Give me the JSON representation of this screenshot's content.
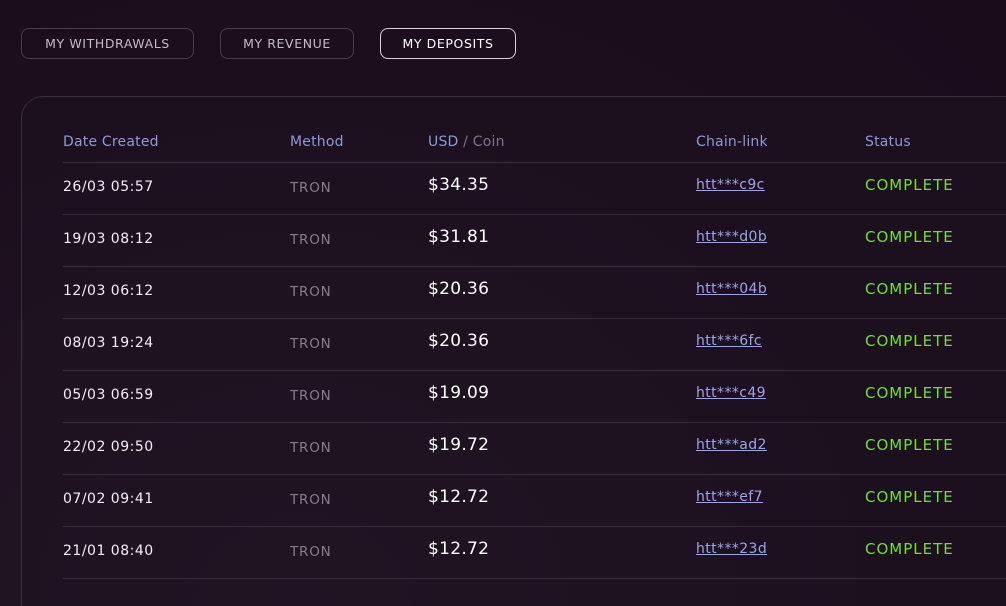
{
  "tabs": [
    {
      "label": "MY WITHDRAWALS",
      "active": false
    },
    {
      "label": "MY REVENUE",
      "active": false
    },
    {
      "label": "MY DEPOSITS",
      "active": true
    }
  ],
  "table": {
    "headers": {
      "date": "Date Created",
      "method": "Method",
      "usd": "USD",
      "usd_sep": " / ",
      "coin": "Coin",
      "chain": "Chain-link",
      "status": "Status"
    },
    "rows": [
      {
        "date": "26/03 05:57",
        "method": "TRON",
        "usd": "$34.35",
        "chain": "htt***c9c",
        "status": "COMPLETE"
      },
      {
        "date": "19/03 08:12",
        "method": "TRON",
        "usd": "$31.81",
        "chain": "htt***d0b",
        "status": "COMPLETE"
      },
      {
        "date": "12/03 06:12",
        "method": "TRON",
        "usd": "$20.36",
        "chain": "htt***04b",
        "status": "COMPLETE"
      },
      {
        "date": "08/03 19:24",
        "method": "TRON",
        "usd": "$20.36",
        "chain": "htt***6fc",
        "status": "COMPLETE"
      },
      {
        "date": "05/03 06:59",
        "method": "TRON",
        "usd": "$19.09",
        "chain": "htt***c49",
        "status": "COMPLETE"
      },
      {
        "date": "22/02 09:50",
        "method": "TRON",
        "usd": "$19.72",
        "chain": "htt***ad2",
        "status": "COMPLETE"
      },
      {
        "date": "07/02 09:41",
        "method": "TRON",
        "usd": "$12.72",
        "chain": "htt***ef7",
        "status": "COMPLETE"
      },
      {
        "date": "21/01 08:40",
        "method": "TRON",
        "usd": "$12.72",
        "chain": "htt***23d",
        "status": "COMPLETE"
      }
    ]
  },
  "colors": {
    "background": "#1d0f1e",
    "header_text": "#8c9bd8",
    "link": "#9ea5e6",
    "status_complete": "#6fe02e",
    "method_text": "#857d8c"
  }
}
